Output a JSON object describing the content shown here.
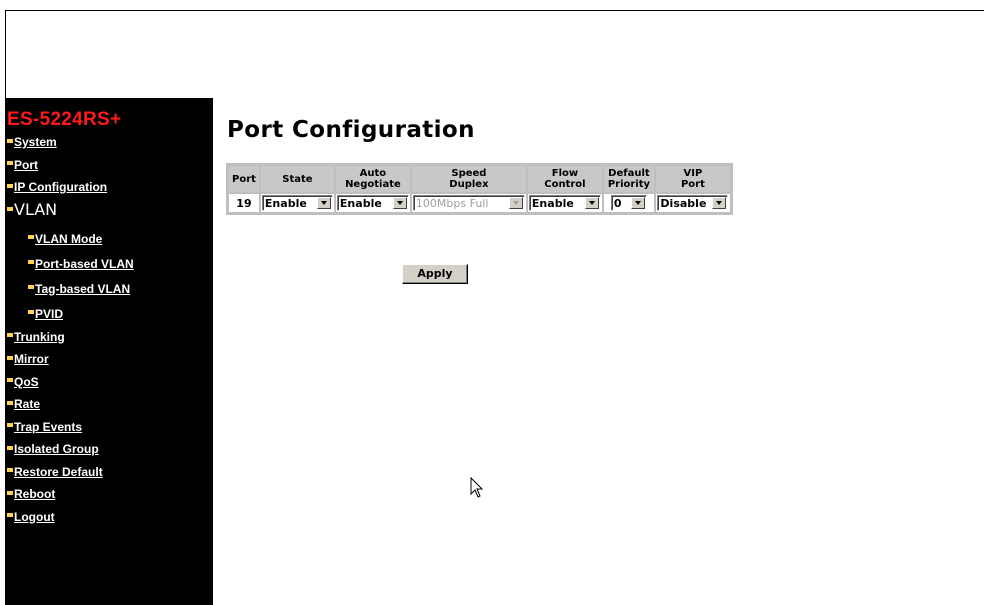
{
  "sidebar": {
    "model": "ES-5224RS+",
    "items": [
      {
        "label": "System"
      },
      {
        "label": "Port"
      },
      {
        "label": "IP Configuration"
      },
      {
        "label": "VLAN"
      },
      {
        "label": "VLAN Mode"
      },
      {
        "label": "Port-based VLAN"
      },
      {
        "label": "Tag-based VLAN"
      },
      {
        "label": "PVID"
      },
      {
        "label": "Trunking"
      },
      {
        "label": "Mirror"
      },
      {
        "label": "QoS"
      },
      {
        "label": "Rate"
      },
      {
        "label": "Trap Events"
      },
      {
        "label": "Isolated Group"
      },
      {
        "label": "Restore Default"
      },
      {
        "label": "Reboot"
      },
      {
        "label": "Logout"
      }
    ]
  },
  "page": {
    "title": "Port Configuration",
    "apply_label": "Apply"
  },
  "table": {
    "headers": {
      "port": "Port",
      "state": "State",
      "auto_negotiate": [
        "Auto",
        "Negotiate"
      ],
      "speed_duplex": [
        "Speed",
        "Duplex"
      ],
      "flow_control": [
        "Flow",
        "Control"
      ],
      "default_priority": [
        "Default",
        "Priority"
      ],
      "vip_port": [
        "VIP",
        "Port"
      ]
    },
    "row": {
      "port": "19",
      "state": "Enable",
      "auto_negotiate": "Enable",
      "speed_duplex": "100Mbps Full",
      "flow_control": "Enable",
      "default_priority": "0",
      "vip_port": "Disable"
    }
  },
  "colors": {
    "sidebar_bg": "#000000",
    "model_text": "#ff1a1a",
    "bullet": "#ffd34d"
  },
  "icons": {
    "cursor": "mouse-pointer-icon"
  }
}
